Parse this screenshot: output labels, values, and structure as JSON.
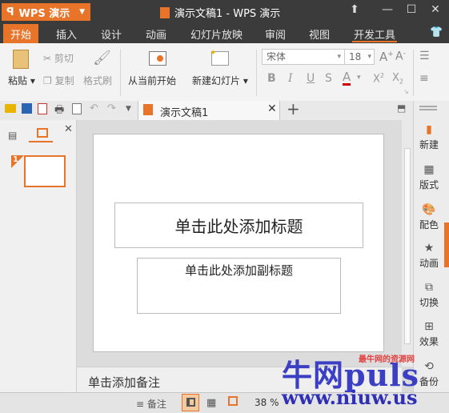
{
  "app": {
    "menu_label": "WPS 演示",
    "document_title": "演示文稿1 - WPS 演示"
  },
  "tabs": [
    "开始",
    "插入",
    "设计",
    "动画",
    "幻灯片放映",
    "审阅",
    "视图",
    "开发工具"
  ],
  "ribbon": {
    "paste": "粘贴",
    "cut": "剪切",
    "copy": "复制",
    "format_painter": "格式刷",
    "from_current": "从当前开始",
    "new_slide": "新建幻灯片",
    "font_name": "宋体",
    "font_size": "18"
  },
  "doc_tab": {
    "name": "演示文稿1"
  },
  "thumbnails": [
    {
      "number": "1"
    }
  ],
  "slide": {
    "title_placeholder": "单击此处添加标题",
    "subtitle_placeholder": "单击此处添加副标题"
  },
  "notes": {
    "placeholder": "单击添加备注"
  },
  "right_sidebar": [
    "新建",
    "版式",
    "配色",
    "动画",
    "切换",
    "效果",
    "备份"
  ],
  "status": {
    "notes_label": "备注",
    "zoom": "38 %"
  },
  "watermark": {
    "brand": "牛网puls",
    "tag": "最牛网的资源网",
    "url": "www.niuw.us"
  },
  "colors": {
    "accent": "#e8742a",
    "titlebar": "#3b3b3b"
  }
}
